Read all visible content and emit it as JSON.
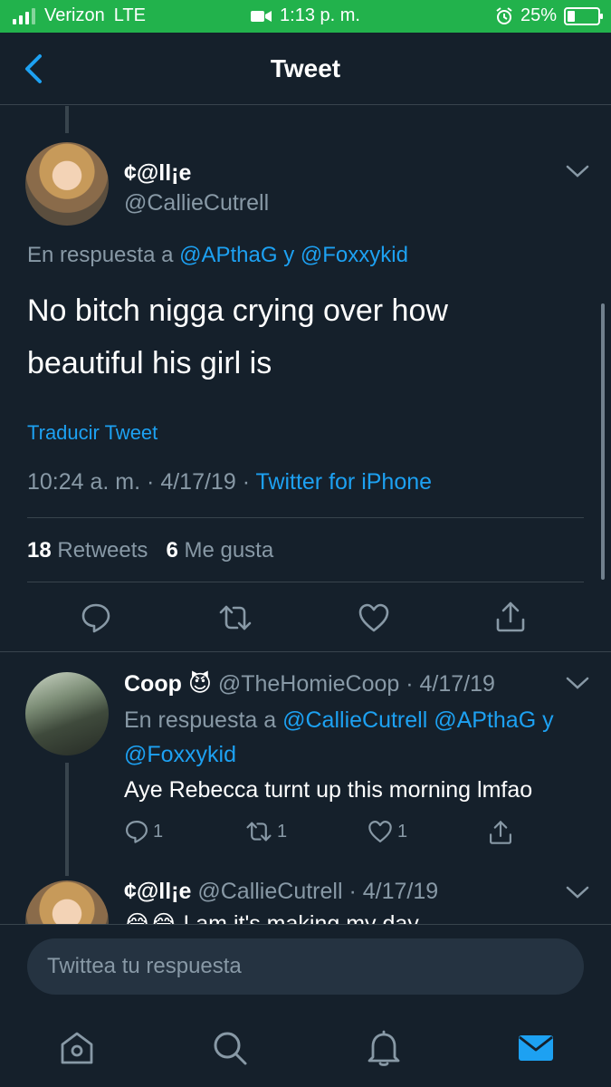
{
  "status_bar": {
    "carrier": "Verizon",
    "network": "LTE",
    "time": "1:13 p. m.",
    "battery": "25%"
  },
  "nav": {
    "title": "Tweet"
  },
  "main_tweet": {
    "name": "¢@ll¡e",
    "handle": "@CallieCutrell",
    "reply_prefix": "En respuesta a",
    "reply_user1": "@APthaG",
    "reply_joiner": "y",
    "reply_user2": "@Foxxykid",
    "text": "No bitch nigga crying over how beautiful his girl is",
    "translate": "Traducir Tweet",
    "time": "10:24 a. m.",
    "date": "4/17/19",
    "source": "Twitter for iPhone",
    "retweets_count": "18",
    "retweets_label": "Retweets",
    "likes_count": "6",
    "likes_label": "Me gusta"
  },
  "reply_tweet": {
    "name": "Coop",
    "emoji": "😈",
    "handle_date": "@TheHomieCoop · 4/17/19",
    "reply_prefix": "En respuesta a",
    "reply_user1": "@CallieCutrell",
    "reply_user2": "@APthaG",
    "reply_joiner": "y",
    "reply_user3": "@Foxxykid",
    "text": "Aye Rebecca turnt up this morning lmfao",
    "reply_count": "1",
    "retweet_count": "1",
    "like_count": "1"
  },
  "third_tweet": {
    "name": "¢@ll¡e",
    "handle_date": "@CallieCutrell · 4/17/19",
    "emoji": "😂😂",
    "text": "I am it's making my day"
  },
  "composer": {
    "placeholder": "Twittea tu respuesta"
  },
  "tabs": [
    "home",
    "search",
    "notifications",
    "messages"
  ],
  "colors": {
    "background": "#15202b",
    "accent": "#1da1f2",
    "muted": "#8899a6",
    "status_bar": "#22b24c"
  }
}
